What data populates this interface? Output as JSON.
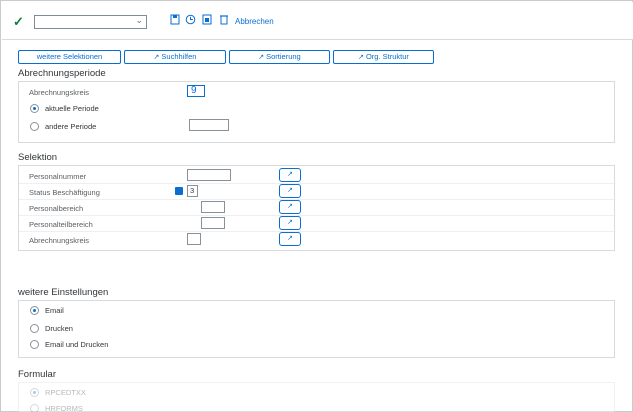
{
  "toolbar": {
    "execute_icon": "check-icon",
    "variant_value": "",
    "cancel_label": "Abbrechen",
    "icons": [
      "save-variant-icon",
      "clock-icon",
      "select-icon",
      "delete-icon"
    ]
  },
  "buttons": [
    {
      "label": "weitere Selektionen",
      "icon": ""
    },
    {
      "label": "Suchhilfen",
      "icon": "arrow-up-right-icon"
    },
    {
      "label": "Sortierung",
      "icon": "arrow-up-right-icon"
    },
    {
      "label": "Org. Struktur",
      "icon": "arrow-up-right-icon"
    }
  ],
  "abrechnungsperiode": {
    "title": "Abrechnungsperiode",
    "field_label": "Abrechnungskreis",
    "field_value": "9",
    "radios": [
      {
        "label": "aktuelle Periode",
        "selected": true
      },
      {
        "label": "andere Periode",
        "selected": false
      }
    ]
  },
  "selektion": {
    "title": "Selektion",
    "rows": [
      {
        "label": "Personalnummer",
        "value": ""
      },
      {
        "label": "Status Beschäftigung",
        "value": "3"
      },
      {
        "label": "Personalbereich",
        "value": ""
      },
      {
        "label": "Personalteilbereich",
        "value": ""
      },
      {
        "label": "Abrechnungskreis",
        "value": ""
      }
    ]
  },
  "einstellungen": {
    "title": "weitere Einstellungen",
    "radios": [
      {
        "label": "Email",
        "selected": true
      },
      {
        "label": "Drucken",
        "selected": false
      },
      {
        "label": "Email und Drucken",
        "selected": false
      }
    ]
  },
  "formular": {
    "title": "Formular",
    "radios": [
      {
        "label": "RPCEDTXX",
        "selected": true
      },
      {
        "label": "HRFORMS",
        "selected": false
      }
    ]
  }
}
